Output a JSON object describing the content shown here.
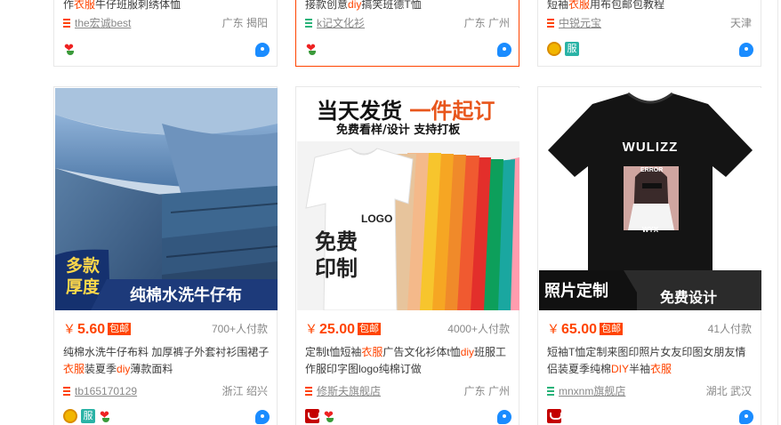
{
  "colors": {
    "accent": "#ff4400",
    "link": "#888888",
    "tmall_red": "#c40000"
  },
  "top_row": [
    {
      "title_pre": "作",
      "title_hl": "衣服",
      "title_post": "牛仔班服刺绣体恤",
      "shop": "the宏诚best",
      "location": "广东 揭阳",
      "badges": [
        "flower"
      ],
      "active": false
    },
    {
      "title_pre": "接款创意",
      "title_hl": "diy",
      "title_post": "搞笑班德T恤",
      "shop": "k记文化衫",
      "location": "广东 广州",
      "badges": [
        "flower"
      ],
      "active": true
    },
    {
      "title_pre": "短袖",
      "title_hl": "衣服",
      "title_post": "用布包邮包教程",
      "shop": "中锐元宝",
      "location": "天津",
      "badges": [
        "gold",
        "fu"
      ],
      "active": false
    }
  ],
  "products": [
    {
      "image_text": {
        "badge_line1": "多款",
        "badge_line2": "厚度",
        "banner": "纯棉水洗牛仔布"
      },
      "price": "5.60",
      "currency": "￥",
      "tag": "包邮",
      "sold": "700+人付款",
      "title_parts": [
        "纯棉水洗牛仔布料 加厚裤子外套衬衫围裙子",
        "衣服",
        "装夏季",
        "diy",
        "薄款面料"
      ],
      "shop": "tb165170129",
      "location": "浙江 绍兴",
      "badges": [
        "gold",
        "fu",
        "flower"
      ]
    },
    {
      "image_text": {
        "headline_a": "当天发货",
        "headline_b": "一件起订",
        "subline": "免费看样/设计 支持打板",
        "logo": "LOGO",
        "free1": "免费",
        "free2": "印制"
      },
      "price": "25.00",
      "currency": "￥",
      "tag": "包邮",
      "sold": "4000+人付款",
      "title_parts": [
        "定制t恤短袖",
        "衣服",
        "广告文化衫体t恤",
        "diy",
        "班服工作服印字图logo纯棉订做"
      ],
      "shop": "修斯夫旗舰店",
      "location": "广东 广州",
      "badges": [
        "tmall",
        "flower"
      ]
    },
    {
      "image_text": {
        "shirt_brand": "WULIZZ",
        "shirt_tag": "ERROR",
        "shirt_sub": "WYX",
        "banner_left": "照片定制",
        "banner_right": "免费设计"
      },
      "price": "65.00",
      "currency": "￥",
      "tag": "包邮",
      "sold": "41人付款",
      "title_parts": [
        "短袖T恤定制来图印照片女友印图女朋友情侣装夏季纯棉",
        "DIY",
        "半袖",
        "衣服",
        ""
      ],
      "shop": "mnxnm旗舰店",
      "location": "湖北 武汉",
      "badges": [
        "tmall"
      ]
    }
  ]
}
